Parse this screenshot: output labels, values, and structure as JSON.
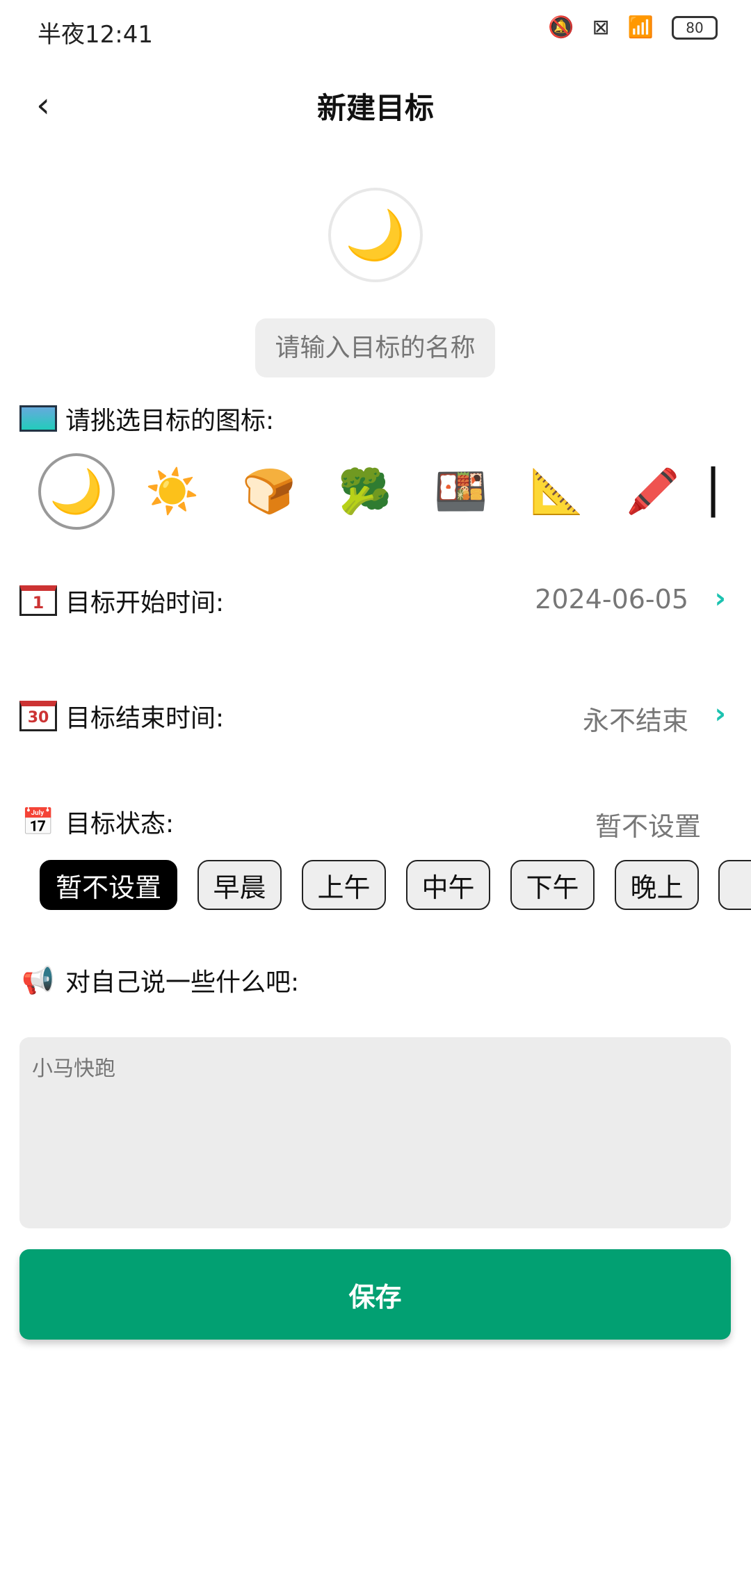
{
  "status_bar": {
    "time": "半夜12:41",
    "battery": "80",
    "icons": [
      "mute-icon",
      "sim-off-icon",
      "wifi-icon",
      "battery-icon"
    ]
  },
  "header": {
    "title": "新建目标",
    "back_icon": "chevron-left-icon"
  },
  "avatar": {
    "icon": "moon-cloud-icon",
    "glyph": "🌙"
  },
  "name_input": {
    "placeholder": "请输入目标的名称",
    "value": ""
  },
  "icon_picker": {
    "label": "请挑选目标的图标:",
    "items": [
      {
        "name": "moon-cloud-icon",
        "glyph": "🌙",
        "selected": true
      },
      {
        "name": "sun-icon",
        "glyph": "☀️",
        "selected": false
      },
      {
        "name": "toast-icon",
        "glyph": "🍞",
        "selected": false
      },
      {
        "name": "meal-plate-icon",
        "glyph": "🥦",
        "selected": false
      },
      {
        "name": "food-cloche-icon",
        "glyph": "🍱",
        "selected": false
      },
      {
        "name": "ruler-pencil-icon",
        "glyph": "📐",
        "selected": false
      },
      {
        "name": "highlighter-icon",
        "glyph": "🖍️",
        "selected": false
      },
      {
        "name": "partial-icon",
        "glyph": "▏",
        "selected": false
      }
    ]
  },
  "start_time": {
    "label": "目标开始时间:",
    "value": "2024-06-05",
    "icon_text": "1"
  },
  "end_time": {
    "label": "目标结束时间:",
    "value": "永不结束",
    "icon_text": "30"
  },
  "goal_status": {
    "label": "目标状态:",
    "value": "暂不设置",
    "options": [
      "暂不设置",
      "早晨",
      "上午",
      "中午",
      "下午",
      "晚上"
    ],
    "selected": "暂不设置"
  },
  "message": {
    "label": "对自己说一些什么吧:",
    "placeholder": "小马快跑"
  },
  "save_button": {
    "label": "保存",
    "color": "#02a072"
  }
}
